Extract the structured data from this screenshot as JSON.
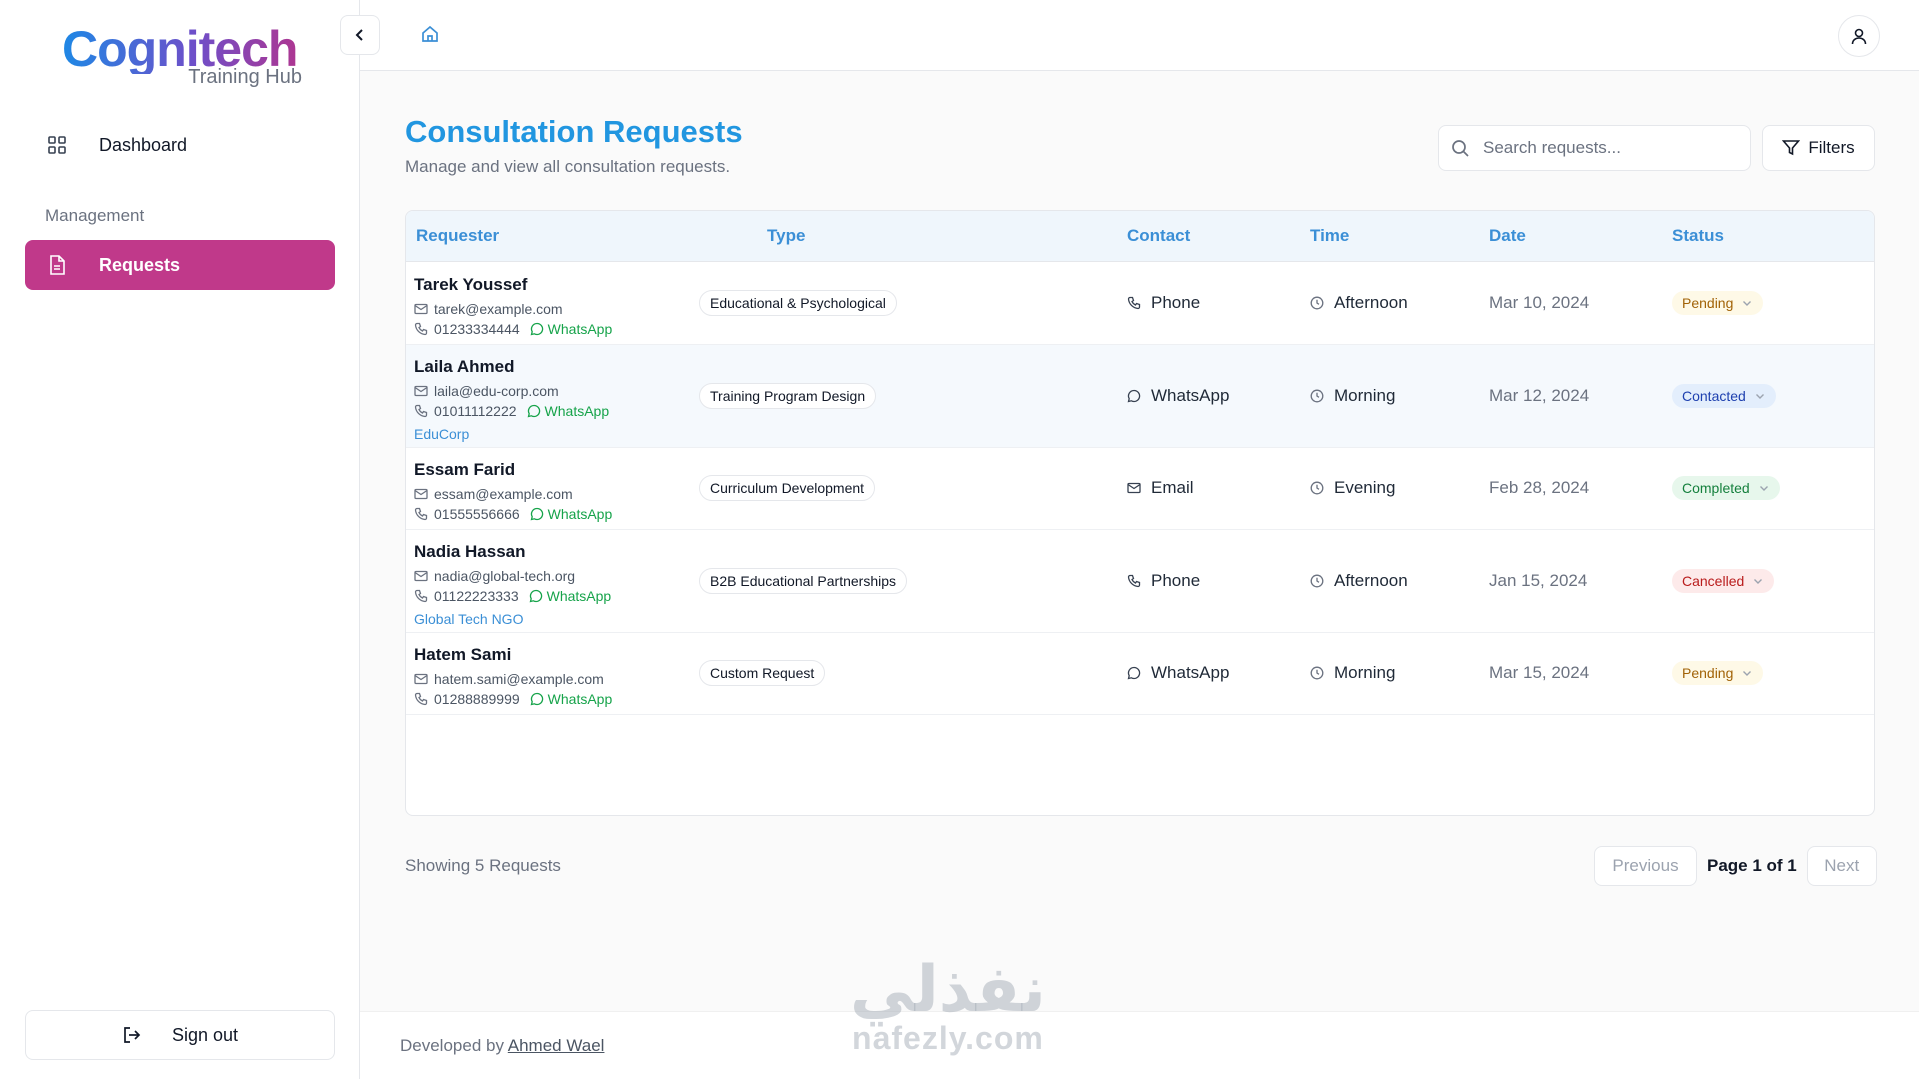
{
  "app": {
    "logo_main": "Cognitech",
    "logo_sub": "Training Hub"
  },
  "sidebar": {
    "dashboard_label": "Dashboard",
    "section_label": "Management",
    "requests_label": "Requests",
    "signout_label": "Sign out"
  },
  "header": {
    "title": "Consultation Requests",
    "subtitle": "Manage and view all consultation requests.",
    "search_placeholder": "Search requests...",
    "filters_label": "Filters"
  },
  "table": {
    "columns": [
      "Requester",
      "Type",
      "Contact",
      "Time",
      "Date",
      "Status"
    ],
    "whatsapp_label": "WhatsApp",
    "rows": [
      {
        "name": "Tarek Youssef",
        "email": "tarek@example.com",
        "phone": "01233334444",
        "org": "",
        "type": "Educational & Psychological",
        "contact": "Phone",
        "contact_icon": "phone-icon",
        "time": "Afternoon",
        "date": "Mar 10, 2024",
        "status": "Pending",
        "status_color": "#a16207",
        "status_bg": "#fef9e7"
      },
      {
        "name": "Laila Ahmed",
        "email": "laila@edu-corp.com",
        "phone": "01011112222",
        "org": "EduCorp",
        "type": "Training Program Design",
        "contact": "WhatsApp",
        "contact_icon": "chat-icon",
        "time": "Morning",
        "date": "Mar 12, 2024",
        "status": "Contacted",
        "status_color": "#1e40af",
        "status_bg": "#e3eefc"
      },
      {
        "name": "Essam Farid",
        "email": "essam@example.com",
        "phone": "01555556666",
        "org": "",
        "type": "Curriculum Development",
        "contact": "Email",
        "contact_icon": "mail-icon",
        "time": "Evening",
        "date": "Feb 28, 2024",
        "status": "Completed",
        "status_color": "#15803d",
        "status_bg": "#e7f7ec"
      },
      {
        "name": "Nadia Hassan",
        "email": "nadia@global-tech.org",
        "phone": "01122223333",
        "org": "Global Tech NGO",
        "type": "B2B Educational Partnerships",
        "contact": "Phone",
        "contact_icon": "phone-icon",
        "time": "Afternoon",
        "date": "Jan 15, 2024",
        "status": "Cancelled",
        "status_color": "#b91c1c",
        "status_bg": "#fdeaea"
      },
      {
        "name": "Hatem Sami",
        "email": "hatem.sami@example.com",
        "phone": "01288889999",
        "org": "",
        "type": "Custom Request",
        "contact": "WhatsApp",
        "contact_icon": "chat-icon",
        "time": "Morning",
        "date": "Mar 15, 2024",
        "status": "Pending",
        "status_color": "#a16207",
        "status_bg": "#fef9e7"
      }
    ]
  },
  "pagination": {
    "showing_text": "Showing 5 Requests",
    "previous_label": "Previous",
    "page_info": "Page 1 of 1",
    "next_label": "Next"
  },
  "footer": {
    "prefix": "Developed by",
    "author": "Ahmed Wael"
  },
  "watermark": {
    "arabic": "نفذلي",
    "latin": "nafezly.com"
  }
}
